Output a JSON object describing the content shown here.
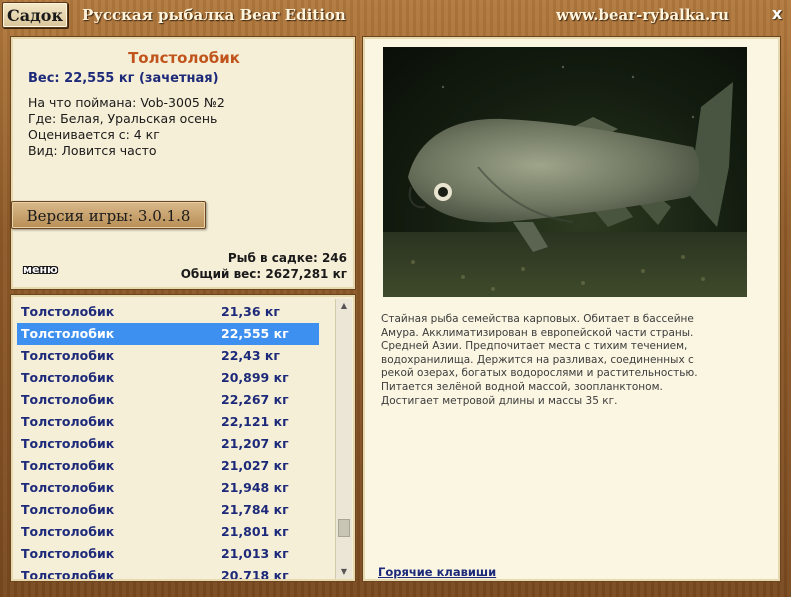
{
  "titlebar": {
    "sadok_label": "Садок",
    "app_title": "Русская рыбалка Bear Edition",
    "site_url": "www.bear-rybalka.ru",
    "close_symbol": "x"
  },
  "fish": {
    "name": "Толстолобик",
    "weight": "Вес: 22,555 кг (зачетная)",
    "caught_with": "На что поймана: Vob-3005 №2",
    "where": "Где: Белая, Уральская осень",
    "valued_from": "Оценивается с: 4 кг",
    "kind": "Вид: Ловится часто"
  },
  "version_label": "Версия игры: 3.0.1.8",
  "menu_label": "меню",
  "stats": {
    "fish_count": "Рыб в садке: 246",
    "total_weight": "Общий вес: 2627,281 кг"
  },
  "list": {
    "selected_index": 1,
    "rows": [
      {
        "name": "Толстолобик",
        "weight": "21,36 кг"
      },
      {
        "name": "Толстолобик",
        "weight": "22,555 кг"
      },
      {
        "name": "Толстолобик",
        "weight": "22,43 кг"
      },
      {
        "name": "Толстолобик",
        "weight": "20,899 кг"
      },
      {
        "name": "Толстолобик",
        "weight": "22,267 кг"
      },
      {
        "name": "Толстолобик",
        "weight": "22,121 кг"
      },
      {
        "name": "Толстолобик",
        "weight": "21,207 кг"
      },
      {
        "name": "Толстолобик",
        "weight": "21,027 кг"
      },
      {
        "name": "Толстолобик",
        "weight": "21,948 кг"
      },
      {
        "name": "Толстолобик",
        "weight": "21,784 кг"
      },
      {
        "name": "Толстолобик",
        "weight": "21,801 кг"
      },
      {
        "name": "Толстолобик",
        "weight": "21,013 кг"
      },
      {
        "name": "Толстолобик",
        "weight": "20,718 кг"
      }
    ]
  },
  "description": "Стайная рыба семейства карповых. Обитает в бассейне Амура. Акклиматизирован в европейской части страны. Средней Азии. Предпочитает места с тихим течением, водохранилища. Держится на разливах, соединенных с рекой озерах, богатых водорослями и растительностью. Питается зелёной водной массой, зоопланктоном. Достигает метровой длины и массы 35 кг.",
  "hotkeys_label": "Горячие клавиши",
  "colors": {
    "frame_wood": "#8e5a28",
    "panel_bg": "#f6efd7",
    "fish_name": "#c0541c",
    "link_blue": "#1d2a7a",
    "selected_row": "#3d8ff0"
  }
}
